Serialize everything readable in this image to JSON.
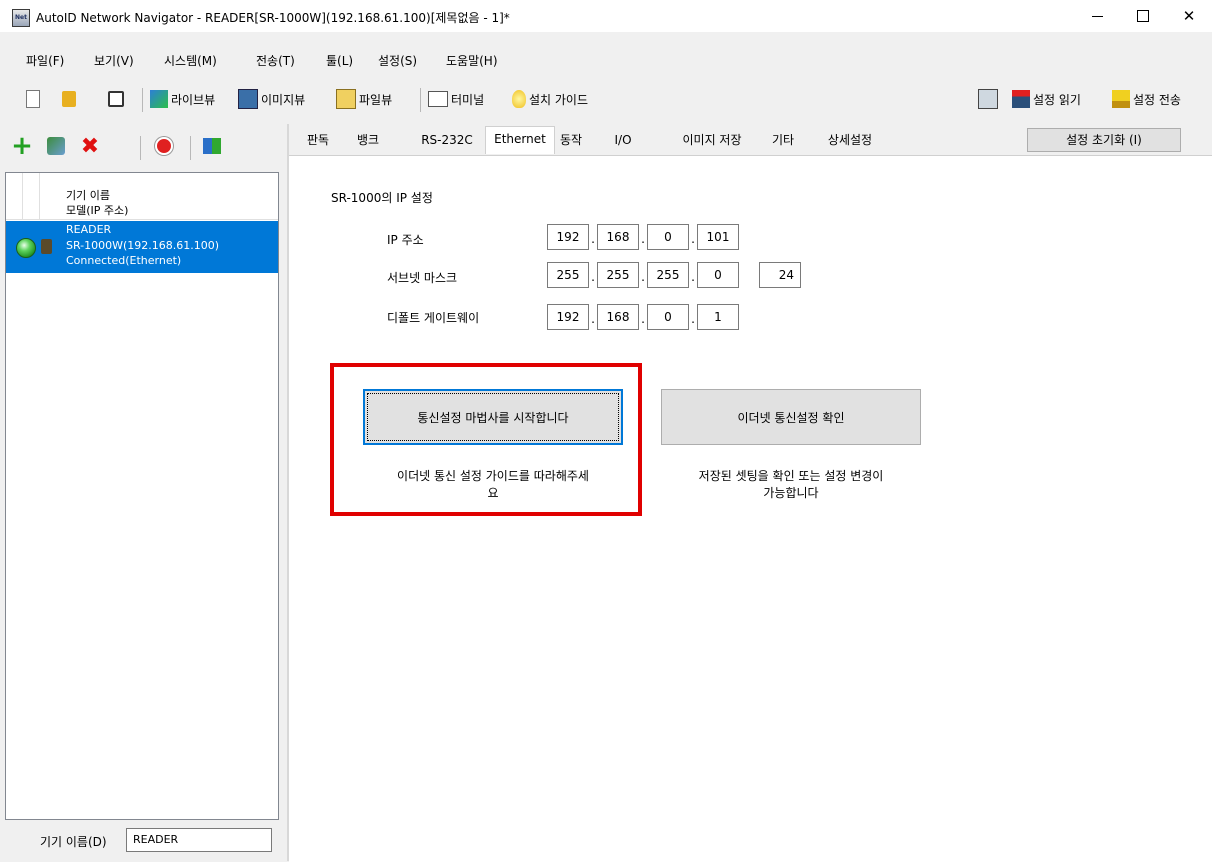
{
  "window": {
    "title": "AutoID Network Navigator - READER[SR-1000W](192.168.61.100)[제목없음 - 1]*",
    "icon_text": "Net",
    "controls": {
      "minimize_icon": "minimize-icon",
      "maximize_icon": "maximize-icon",
      "close_symbol": "✕"
    }
  },
  "menu": [
    "파일(F)",
    "보기(V)",
    "시스템(M)",
    "전송(T)",
    "툴(L)",
    "설정(S)",
    "도움말(H)"
  ],
  "toolbar": {
    "live_view": "라이브뷰",
    "image_view": "이미지뷰",
    "file_view": "파일뷰",
    "terminal": "터미널",
    "install_guide": "설치 가이드",
    "read_settings": "설정 읽기",
    "send_settings": "설정 전송"
  },
  "left_panel": {
    "header_name": "기기 이름",
    "header_model": "모델(IP 주소)",
    "devices": [
      {
        "name": "READER",
        "model": "SR-1000W(192.168.61.100)",
        "status": "Connected(Ethernet)",
        "status_color": "#2db52d"
      }
    ],
    "name_label": "기기 이름(D)",
    "name_value": "READER"
  },
  "tabs": {
    "items": [
      "판독",
      "뱅크",
      "RS-232C",
      "Ethernet",
      "동작",
      "I/O",
      "이미지 저장",
      "기타",
      "상세설정"
    ],
    "selected": "Ethernet",
    "reset_button": "설정 초기화 (I)"
  },
  "ethernet": {
    "section_title": "SR-1000의 IP 설정",
    "ip_label": "IP 주소",
    "ip": [
      "192",
      "168",
      "0",
      "101"
    ],
    "subnet_label": "서브넷 마스크",
    "subnet": [
      "255",
      "255",
      "255",
      "0"
    ],
    "prefix": "24",
    "gateway_label": "디폴트 게이트웨이",
    "gateway": [
      "192",
      "168",
      "0",
      "1"
    ],
    "wizard_button": "통신설정 마법사를 시작합니다",
    "wizard_desc_line1": "이더넷 통신 설정 가이드를 따라해주세",
    "wizard_desc_line2": "요",
    "check_button": "이더넷 통신설정 확인",
    "check_desc_line1": "저장된 셋팅을 확인 또는 설정 변경이",
    "check_desc_line2": "가능합니다",
    "highlight_color": "#e00000"
  }
}
